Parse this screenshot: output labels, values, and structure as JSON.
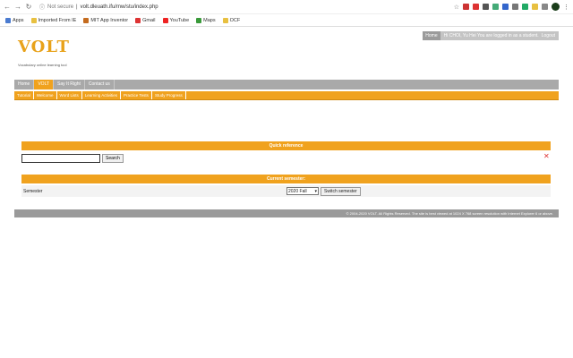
{
  "browser": {
    "security": "Not secure",
    "url": "volt.dleuath.ifu/mw/stu/index.php"
  },
  "bookmarks": [
    {
      "label": "Apps",
      "color": "#4a7bd0"
    },
    {
      "label": "Imported From IE",
      "color": "#e8c040"
    },
    {
      "label": "MIT App Inventor",
      "color": "#c46b1e"
    },
    {
      "label": "Gmail",
      "color": "#d33"
    },
    {
      "label": "YouTube",
      "color": "#e22"
    },
    {
      "label": "Maps",
      "color": "#3a9a3a"
    },
    {
      "label": "OCF",
      "color": "#e8c040"
    }
  ],
  "site": {
    "logo": "VOLT",
    "tagline": "Vocabulary online learning tool",
    "userbar": {
      "home": "Home",
      "greeting": "Hi CHOI, Yu Hei You are logged in as a student.",
      "logout": "Logout"
    },
    "mainnav": [
      "Home",
      "VOLT",
      "Say It Right",
      "Contact us"
    ],
    "subnav": [
      "Tutorial",
      "Welcome",
      "Word Lists",
      "Learning Activities",
      "Practice Tests",
      "Study Progress"
    ],
    "quick_reference": {
      "title": "Quick reference",
      "search_value": "",
      "search_label": "Search",
      "close": "✕"
    },
    "semester": {
      "title": "Current semester:",
      "label": "Semester",
      "selected": "2020 Fall",
      "switch_label": "Switch semester"
    },
    "footer": "© 2004-2020 VOLT. All Rights Reserved. The site is best viewed at 1024 X 768 screen resolution with Internet Explorer 6 or above."
  }
}
